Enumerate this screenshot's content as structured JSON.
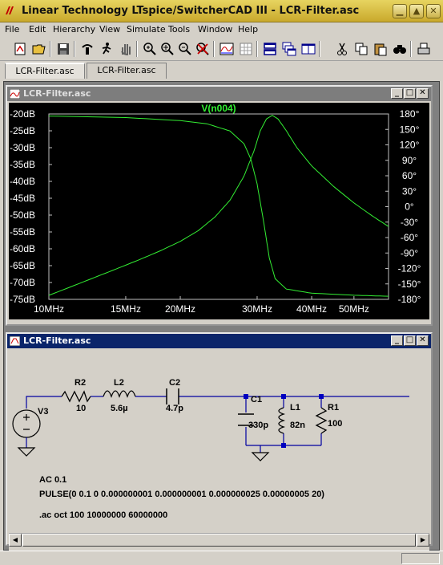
{
  "window": {
    "title": "Linear Technology LTspice/SwitcherCAD III - LCR-Filter.asc"
  },
  "menu": [
    "File",
    "Edit",
    "Hierarchy",
    "View",
    "Simulate",
    "Tools",
    "Window",
    "Help"
  ],
  "toolbar_icons": [
    "new-schematic-icon",
    "open-icon",
    "save-icon",
    "control-panel-icon",
    "run-icon",
    "halt-icon",
    "zoom-in-icon",
    "zoom-pan-icon",
    "zoom-out-icon",
    "zoom-cancel-icon",
    "autorange-icon",
    "waveform-grid-icon",
    "tile-horizontal-icon",
    "cascade-icon",
    "tile-vertical-icon",
    "cut-icon",
    "copy-icon",
    "paste-icon",
    "find-icon",
    "print-icon"
  ],
  "tabs": [
    "LCR-Filter.asc",
    "LCR-Filter.asc"
  ],
  "plot_window": {
    "title": "LCR-Filter.asc"
  },
  "schematic_window": {
    "title": "LCR-Filter.asc"
  },
  "chart_data": {
    "type": "line",
    "title": "V(n004)",
    "title_color": "#33ee33",
    "x_scale": "log",
    "x_range_hz": [
      10000000,
      60000000
    ],
    "x_ticks": [
      {
        "value": 10000000,
        "label": "10MHz"
      },
      {
        "value": 15000000,
        "label": "15MHz"
      },
      {
        "value": 20000000,
        "label": "20MHz"
      },
      {
        "value": 30000000,
        "label": "30MHz"
      },
      {
        "value": 40000000,
        "label": "40MHz"
      },
      {
        "value": 50000000,
        "label": "50MHz"
      }
    ],
    "y_left_ticks": [
      "-20dB",
      "-25dB",
      "-30dB",
      "-35dB",
      "-40dB",
      "-45dB",
      "-50dB",
      "-55dB",
      "-60dB",
      "-65dB",
      "-70dB",
      "-75dB"
    ],
    "y_left_range_db": [
      -75,
      -20
    ],
    "y_right_ticks": [
      "180°",
      "150°",
      "120°",
      "90°",
      "60°",
      "30°",
      "0°",
      "-30°",
      "-60°",
      "-90°",
      "-120°",
      "-150°",
      "-180°"
    ],
    "y_right_range_deg": [
      -180,
      180
    ],
    "grid": false,
    "series": [
      {
        "axis": "left",
        "color": "#33ee33",
        "points": [
          {
            "f": 10000000,
            "db": -73.8
          },
          {
            "f": 12000000,
            "db": -69.8
          },
          {
            "f": 14000000,
            "db": -66.4
          },
          {
            "f": 16000000,
            "db": -63.4
          },
          {
            "f": 18000000,
            "db": -60.6
          },
          {
            "f": 20000000,
            "db": -57.8
          },
          {
            "f": 22000000,
            "db": -54.6
          },
          {
            "f": 24000000,
            "db": -50.6
          },
          {
            "f": 26000000,
            "db": -45.6
          },
          {
            "f": 28000000,
            "db": -38.4
          },
          {
            "f": 29500000,
            "db": -31.0
          },
          {
            "f": 30500000,
            "db": -25.0
          },
          {
            "f": 31500000,
            "db": -21.5
          },
          {
            "f": 32500000,
            "db": -20.4
          },
          {
            "f": 33500000,
            "db": -21.5
          },
          {
            "f": 35000000,
            "db": -25.0
          },
          {
            "f": 37000000,
            "db": -30.0
          },
          {
            "f": 40000000,
            "db": -35.4
          },
          {
            "f": 45000000,
            "db": -41.6
          },
          {
            "f": 50000000,
            "db": -46.4
          },
          {
            "f": 55000000,
            "db": -50.2
          },
          {
            "f": 60000000,
            "db": -53.4
          }
        ]
      },
      {
        "axis": "right",
        "color": "#33ee33",
        "points": [
          {
            "f": 10000000,
            "deg": 176
          },
          {
            "f": 15000000,
            "deg": 173
          },
          {
            "f": 20000000,
            "deg": 167
          },
          {
            "f": 23000000,
            "deg": 161
          },
          {
            "f": 26000000,
            "deg": 147
          },
          {
            "f": 28000000,
            "deg": 122
          },
          {
            "f": 29000000,
            "deg": 93
          },
          {
            "f": 30000000,
            "deg": 44
          },
          {
            "f": 31000000,
            "deg": -26
          },
          {
            "f": 32000000,
            "deg": -100
          },
          {
            "f": 33000000,
            "deg": -140
          },
          {
            "f": 35000000,
            "deg": -160
          },
          {
            "f": 40000000,
            "deg": -168
          },
          {
            "f": 50000000,
            "deg": -172
          },
          {
            "f": 60000000,
            "deg": -174
          }
        ]
      }
    ]
  },
  "schematic": {
    "components": [
      {
        "ref": "V3",
        "value": ""
      },
      {
        "ref": "R2",
        "value": "10"
      },
      {
        "ref": "L2",
        "value": "5.6µ"
      },
      {
        "ref": "C2",
        "value": "4.7p"
      },
      {
        "ref": "C1",
        "value": "330p"
      },
      {
        "ref": "L1",
        "value": "82n"
      },
      {
        "ref": "R1",
        "value": "100"
      }
    ],
    "directives": [
      "AC 0.1",
      "PULSE(0 0.1 0 0.000000001 0.000000001 0.000000025 0.00000005 20)",
      ".ac oct 100 10000000 60000000"
    ]
  }
}
